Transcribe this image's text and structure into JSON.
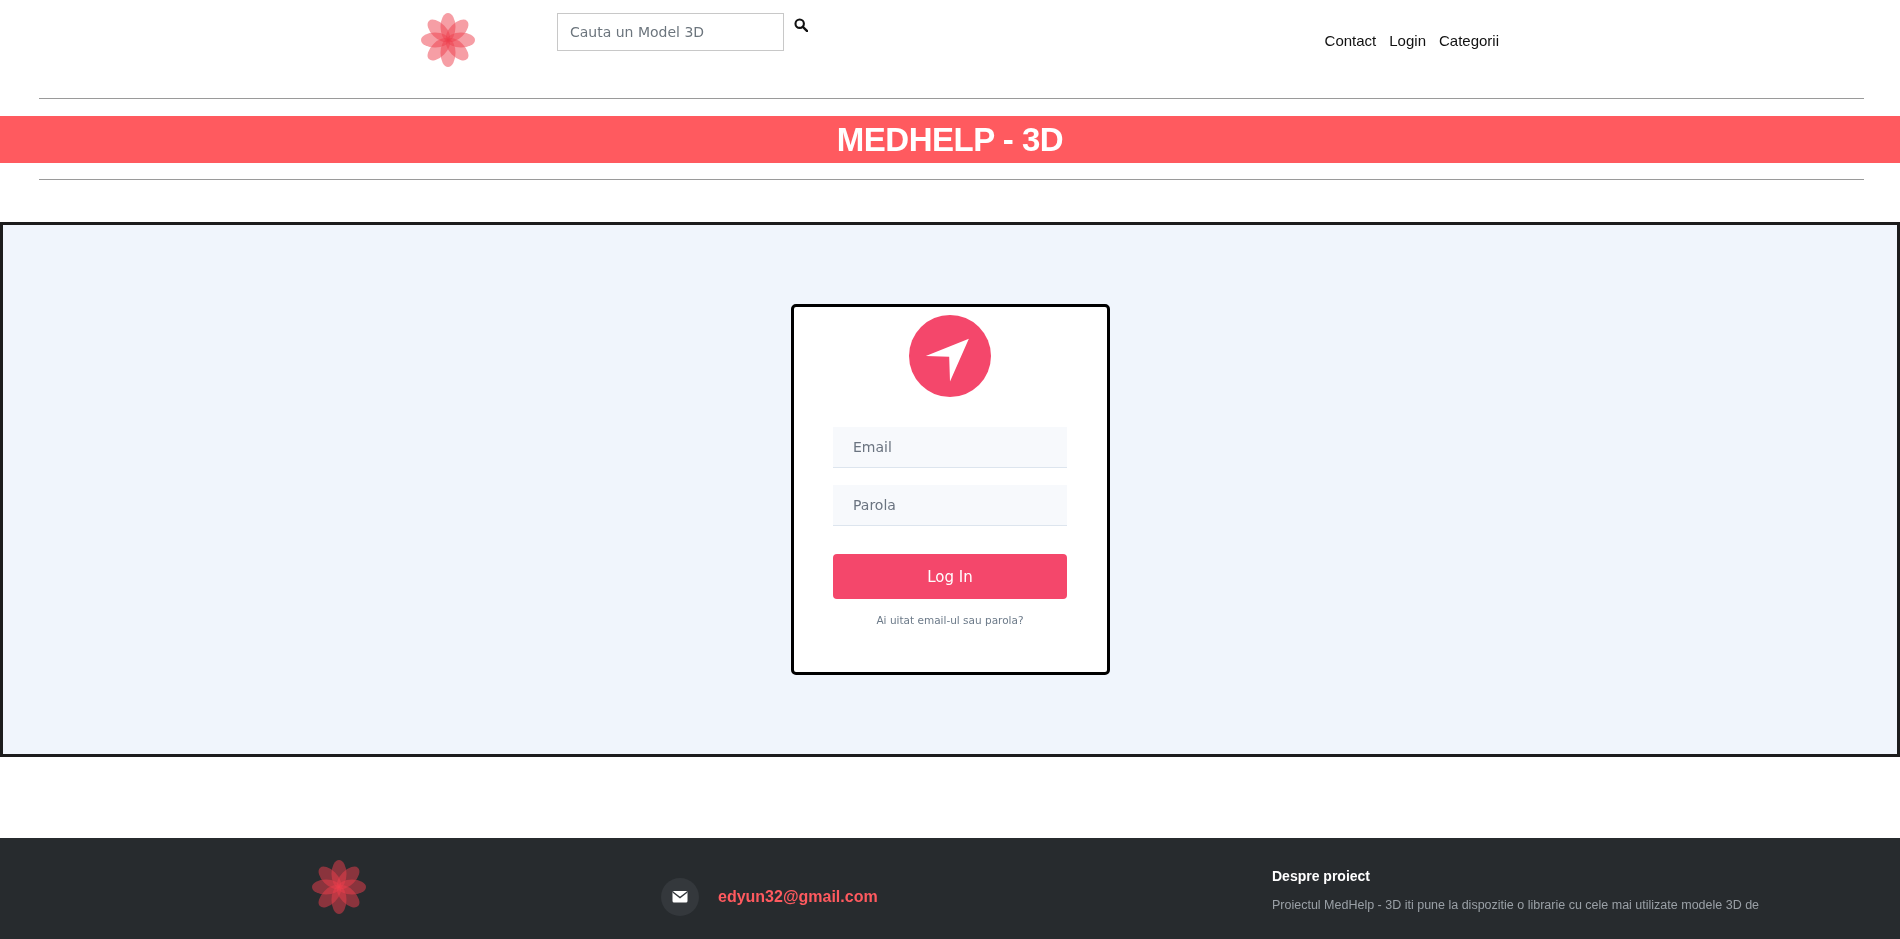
{
  "header": {
    "search": {
      "placeholder": "Cauta un Model 3D"
    },
    "nav": [
      "Contact",
      "Login",
      "Categorii"
    ]
  },
  "banner": {
    "title": "MEDHELP - 3D"
  },
  "login_form": {
    "fields": [
      {
        "placeholder": "Email"
      },
      {
        "placeholder": "Parola"
      }
    ],
    "submit": "Log In",
    "forgot_link": "Ai uitat email-ul sau parola?"
  },
  "footer": {
    "email": "edyun32@gmail.com",
    "about": {
      "title": "Despre proiect",
      "text": "Proiectul MedHelp - 3D iti pune la dispozitie o librarie cu cele mai utilizate modele 3D de"
    }
  }
}
